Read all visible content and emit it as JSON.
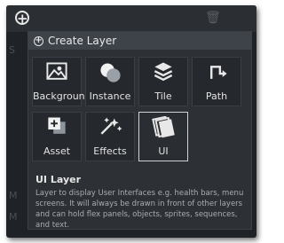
{
  "toolbar": {
    "add_icon": "plus-circle-icon",
    "trash_icon": "trash-icon"
  },
  "side": {
    "ghost1": "S",
    "ghost2": "M",
    "ghost3": "M"
  },
  "popup": {
    "title": "Create Layer",
    "tiles": [
      {
        "label": "Background",
        "icon": "image-icon"
      },
      {
        "label": "Instance",
        "icon": "circles-icon"
      },
      {
        "label": "Tile",
        "icon": "layers-icon"
      },
      {
        "label": "Path",
        "icon": "path-icon"
      },
      {
        "label": "Asset",
        "icon": "asset-icon"
      },
      {
        "label": "Effects",
        "icon": "sparkles-icon"
      },
      {
        "label": "UI",
        "icon": "ui-pages-icon"
      }
    ],
    "selected_tile": "UI",
    "description": {
      "title": "UI Layer",
      "text": "Layer to display User Interfaces e.g. health bars, menu screens. It will always be drawn in front of other layers and can hold flex panels, objects, sprites, sequences, and text."
    }
  }
}
